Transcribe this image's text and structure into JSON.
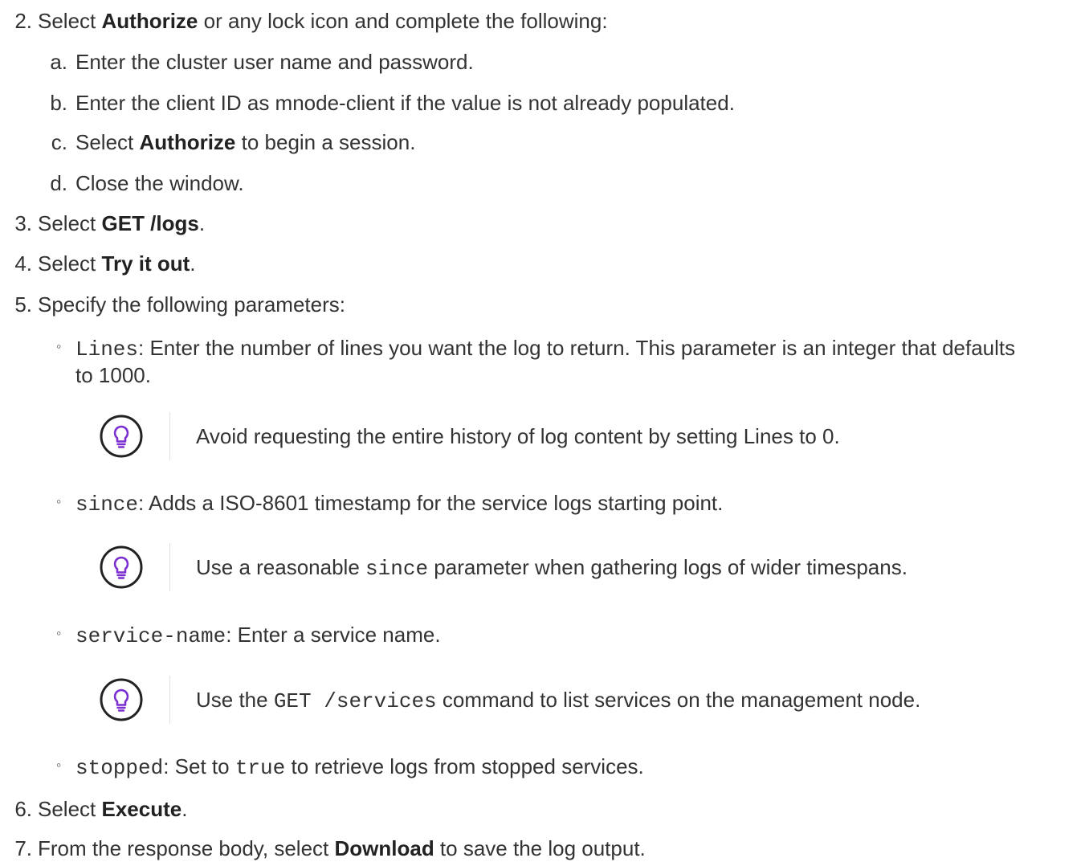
{
  "steps": {
    "s2": {
      "num": "2.",
      "pre": "Select ",
      "b1": "Authorize",
      "post": " or any lock icon and complete the following:"
    },
    "s2a": {
      "num": "a.",
      "text": "Enter the cluster user name and password."
    },
    "s2b": {
      "num": "b.",
      "text": "Enter the client ID as mnode-client if the value is not already populated."
    },
    "s2c": {
      "num": "c.",
      "pre": "Select ",
      "b1": "Authorize",
      "post": " to begin a session."
    },
    "s2d": {
      "num": "d.",
      "text": "Close the window."
    },
    "s3": {
      "num": "3.",
      "pre": "Select ",
      "b1": "GET /logs",
      "post": "."
    },
    "s4": {
      "num": "4.",
      "pre": "Select ",
      "b1": "Try it out",
      "post": "."
    },
    "s5": {
      "num": "5.",
      "text": "Specify the following parameters:"
    },
    "s6": {
      "num": "6.",
      "pre": "Select ",
      "b1": "Execute",
      "post": "."
    },
    "s7": {
      "num": "7.",
      "pre": "From the response body, select ",
      "b1": "Download",
      "post": " to save the log output."
    }
  },
  "params": {
    "bullet": "◦",
    "lines": {
      "code": "Lines",
      "line1": ": Enter the number of lines you want the log to return. This parameter is an integer that defaults",
      "line2": "to 1000."
    },
    "since": {
      "code": "since",
      "text": ": Adds a ISO-8601 timestamp for the service logs starting point."
    },
    "service": {
      "code": "service-name",
      "text": ": Enter a service name."
    },
    "stopped": {
      "code": "stopped",
      "mid": ": Set to ",
      "code2": "true",
      "post": " to retrieve logs from stopped services."
    }
  },
  "tips": {
    "tip1": {
      "text": "Avoid requesting the entire history of log content by setting Lines to 0."
    },
    "tip2": {
      "pre": "Use a reasonable ",
      "code": "since",
      "post": " parameter when gathering logs of wider timespans."
    },
    "tip3": {
      "pre": "Use the ",
      "code": "GET /services",
      "post": " command to list services on the management node."
    }
  },
  "colors": {
    "tip_icon": "#7b2fd0",
    "text": "#333333"
  },
  "icons": {
    "tip": "lightbulb-icon"
  }
}
